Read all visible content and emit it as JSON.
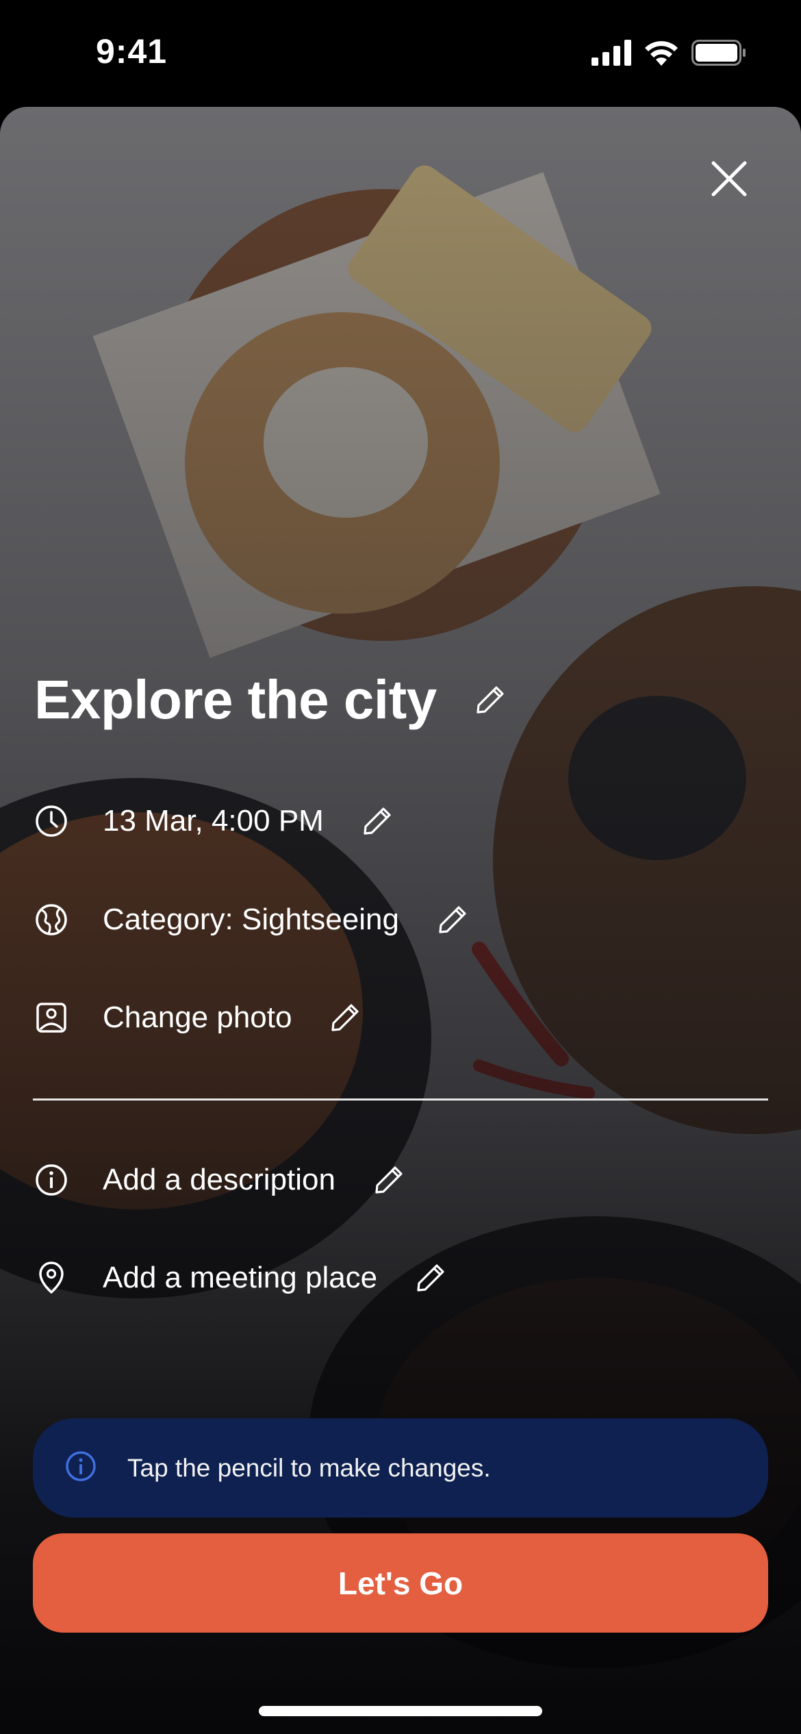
{
  "status_bar": {
    "time": "9:41"
  },
  "sheet": {
    "title": "Explore the city",
    "rows": [
      {
        "icon": "clock-icon",
        "label": "13 Mar, 4:00 PM"
      },
      {
        "icon": "globe-icon",
        "label": "Category: Sightseeing"
      },
      {
        "icon": "image-icon",
        "label": "Change photo"
      }
    ],
    "optional_rows": [
      {
        "icon": "info-icon",
        "label": "Add a description"
      },
      {
        "icon": "location-pin-icon",
        "label": "Add a meeting place"
      }
    ],
    "info_banner": {
      "icon": "info-icon",
      "text": "Tap the pencil to make changes."
    },
    "cta_label": "Let's Go"
  },
  "colors": {
    "banner_bg": "#0f2150",
    "banner_icon": "#3f6fe0",
    "cta_bg": "#e35f40"
  }
}
